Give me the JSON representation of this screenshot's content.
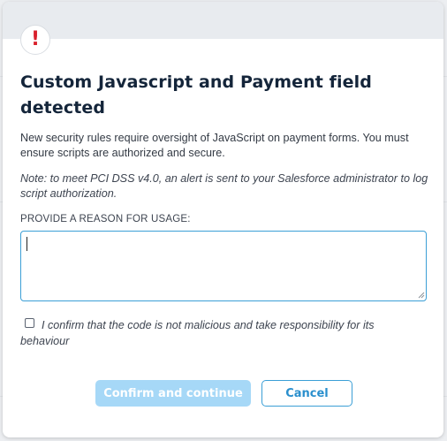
{
  "modal": {
    "alert_icon": "exclamation-icon",
    "alert_glyph": "!",
    "title": "Custom Javascript and Payment field detected",
    "description": "New security rules require oversight of JavaScript on payment forms. You must ensure scripts are authorized and secure.",
    "note": "Note: to meet PCI DSS v4.0, an alert is sent to your Salesforce administrator to log script authorization.",
    "reason_label": "PROVIDE A REASON FOR USAGE:",
    "reason_value": "",
    "confirm_text": "I confirm that the code is not malicious and take responsibility for its behaviour",
    "confirm_checked": false,
    "confirm_button": "Confirm and continue",
    "cancel_button": "Cancel"
  },
  "colors": {
    "accent": "#3b9fd6",
    "primary_disabled": "#a6d8f7",
    "alert": "#d9202c",
    "title": "#14253a"
  }
}
